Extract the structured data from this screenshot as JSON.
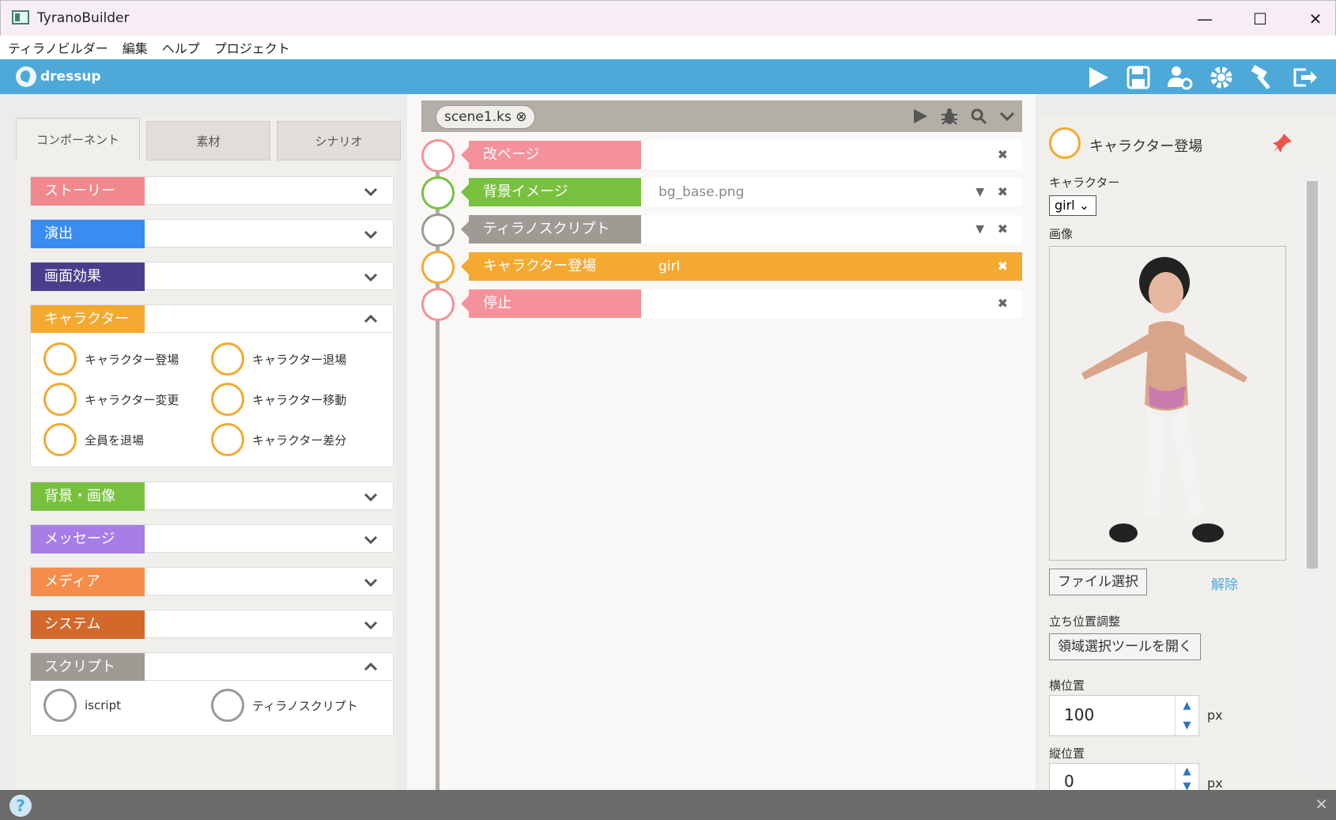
{
  "window": {
    "title": "TyranoBuilder",
    "minimize": "—",
    "maximize": "☐",
    "close": "✕"
  },
  "menu": [
    "ティラノビルダー",
    "編集",
    "ヘルプ",
    "プロジェクト"
  ],
  "appbar": {
    "project": "dressup",
    "icons": [
      "play-icon",
      "save-icon",
      "characters-config-icon",
      "settings-gear-icon",
      "build-hammer-icon",
      "exit-icon"
    ]
  },
  "left": {
    "tabs": [
      "コンポーネント",
      "素材",
      "シナリオ"
    ],
    "categories": [
      {
        "label": "ストーリー",
        "color": "#f0888e"
      },
      {
        "label": "演出",
        "color": "#3a8cf0"
      },
      {
        "label": "画面効果",
        "color": "#4b3d8c"
      },
      {
        "label": "キャラクター",
        "color": "#f4a931"
      },
      {
        "label": "背景・画像",
        "color": "#78c13e"
      },
      {
        "label": "メッセージ",
        "color": "#a77de8"
      },
      {
        "label": "メディア",
        "color": "#f58c4a"
      },
      {
        "label": "システム",
        "color": "#d2692b"
      },
      {
        "label": "スクリプト",
        "color": "#9e9a94"
      }
    ],
    "character_items": [
      "キャラクター登場",
      "キャラクター退場",
      "キャラクター変更",
      "キャラクター移動",
      "全員を退場",
      "キャラクター差分"
    ],
    "script_items": [
      "iscript",
      "ティラノスクリプト"
    ]
  },
  "center": {
    "tab": "scene1.ks ⊗",
    "rows": [
      {
        "label": "改ページ",
        "value": "",
        "color": "#f5919b"
      },
      {
        "label": "背景イメージ",
        "value": "bg_base.png",
        "color": "#78c13e"
      },
      {
        "label": "ティラノスクリプト",
        "value": "",
        "color": "#9e9a94"
      },
      {
        "label": "キャラクター登場",
        "value": "girl",
        "color": "#f4a931"
      },
      {
        "label": "停止",
        "value": "",
        "color": "#f5919b"
      }
    ]
  },
  "right": {
    "title": "キャラクター登場",
    "character_label": "キャラクター",
    "character_value": "girl",
    "image_label": "画像",
    "file_button": "ファイル選択",
    "clear_link": "解除",
    "position_label": "立ち位置調整",
    "area_button": "領域選択ツールを開く",
    "x_label": "横位置",
    "x_value": "100",
    "y_label": "縦位置",
    "y_value": "0",
    "unit": "px"
  },
  "colors": {
    "accent": "#4ea9d8"
  }
}
